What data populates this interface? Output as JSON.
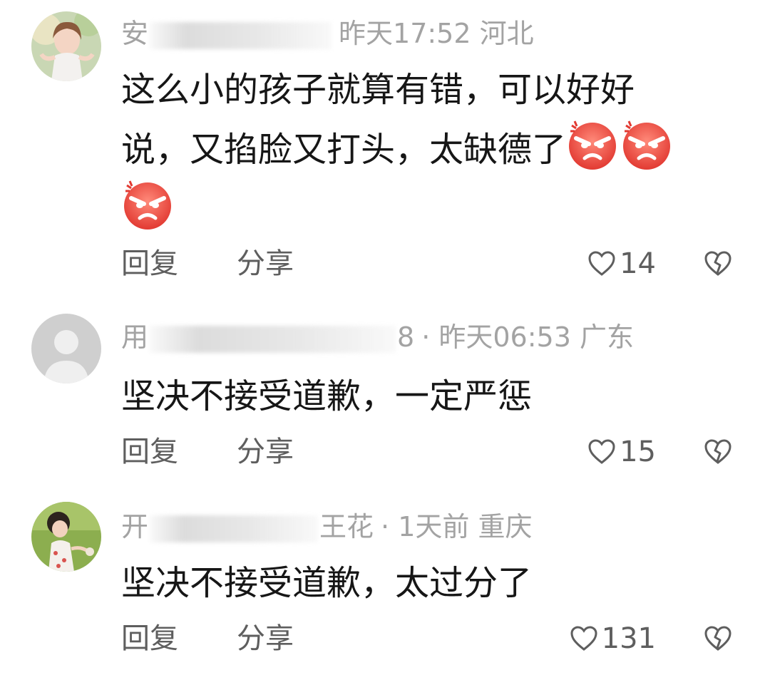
{
  "comments": [
    {
      "name_visible": "安",
      "time_location": "昨天17:52 河北",
      "text_line1": "这么小的孩子就算有错，可以好好",
      "text_line2": "说，又掐脸又打头，太缺德了",
      "emoji_name": "angry-face-icon",
      "emoji_count": 3,
      "reply_label": "回复",
      "share_label": "分享",
      "like_count": "14"
    },
    {
      "name_visible": "用",
      "name_suffix": "8",
      "time_location": "· 昨天06:53 广东",
      "text": "坚决不接受道歉，一定严惩",
      "reply_label": "回复",
      "share_label": "分享",
      "like_count": "15"
    },
    {
      "name_visible": "开",
      "name_suffix": "王花",
      "time_location": "· 1天前 重庆",
      "text": "坚决不接受道歉，太过分了",
      "reply_label": "回复",
      "share_label": "分享",
      "like_count": "131"
    }
  ],
  "colors": {
    "meta_text": "#a3a3a3",
    "action_text": "#5e5e5e",
    "emoji_red": "#e8423c"
  }
}
